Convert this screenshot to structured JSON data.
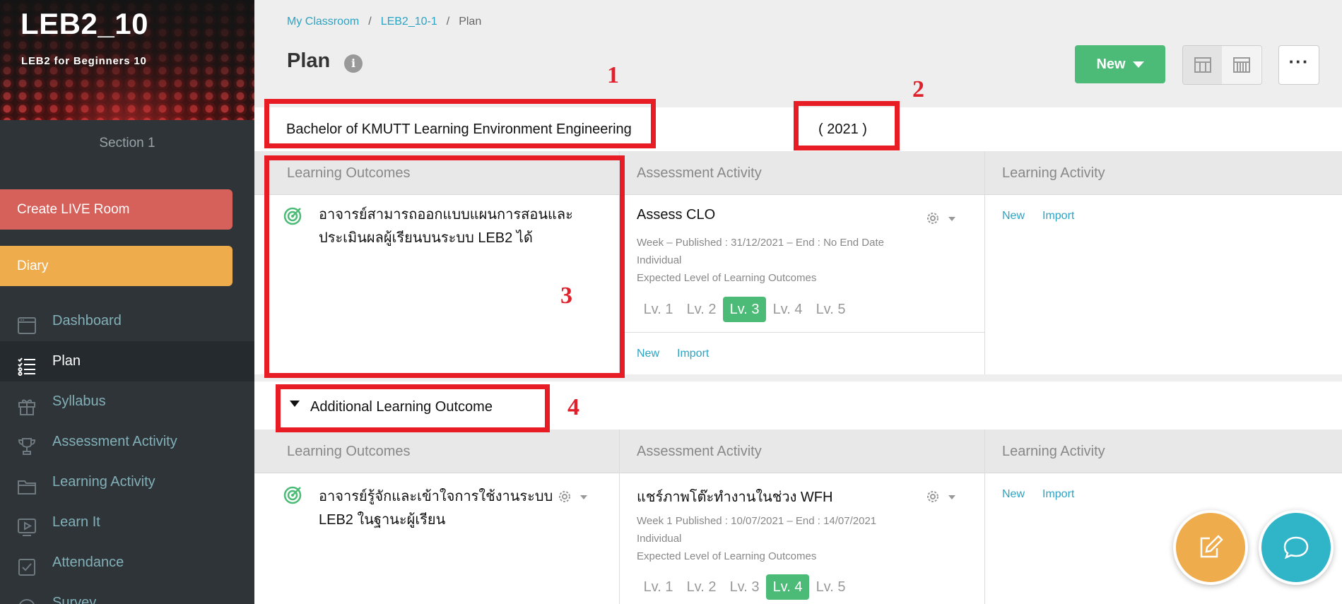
{
  "sidebar": {
    "course_code": "LEB2_10",
    "course_name": "LEB2 for Beginners 10",
    "section": "Section 1",
    "live_button": "Create LIVE Room",
    "diary_button": "Diary",
    "items": [
      {
        "label": "Dashboard",
        "icon": "dashboard-icon"
      },
      {
        "label": "Plan",
        "icon": "list-icon"
      },
      {
        "label": "Syllabus",
        "icon": "gift-icon"
      },
      {
        "label": "Assessment Activity",
        "icon": "trophy-icon"
      },
      {
        "label": "Learning Activity",
        "icon": "folder-icon"
      },
      {
        "label": "Learn It",
        "icon": "video-icon"
      },
      {
        "label": "Attendance",
        "icon": "checkbox-icon"
      },
      {
        "label": "Survey",
        "icon": "smiley-icon"
      }
    ]
  },
  "breadcrumb": {
    "items": [
      "My Classroom",
      "LEB2_10-1",
      "Plan"
    ],
    "separator": "/"
  },
  "header": {
    "title": "Plan",
    "info_icon": "i",
    "new_button": "New",
    "more_button": "···"
  },
  "program": {
    "name": "Bachelor of KMUTT Learning Environment Engineering",
    "year": "( 2021 )"
  },
  "columns": {
    "outcomes": "Learning Outcomes",
    "assessment": "Assessment Activity",
    "learning": "Learning Activity"
  },
  "main_outcome": {
    "text_line1": "อาจารย์สามารถออกแบบแผนการสอนและ",
    "text_line2": "ประเมินผลผู้เรียนบนระบบ LEB2 ได้",
    "activity": {
      "title": "Assess CLO",
      "meta_line1": "Week –   Published : 31/12/2021 – End : No End Date",
      "meta_line2": "Individual",
      "meta_line3": "Expected Level of Learning Outcomes",
      "levels": [
        "Lv. 1",
        "Lv. 2",
        "Lv. 3",
        "Lv. 4",
        "Lv. 5"
      ],
      "selected_level": "Lv. 3"
    },
    "new_link": "New",
    "import_link": "Import"
  },
  "additional": {
    "title": "Additional Learning Outcome",
    "outcome": {
      "text_line1": "อาจารย์รู้จักและเข้าใจการใช้งานระบบ",
      "text_line2": "LEB2 ในฐานะผู้เรียน"
    },
    "activity": {
      "title": "แชร์ภาพโต๊ะทำงานในช่วง WFH",
      "meta_line1": "Week 1   Published : 10/07/2021 – End : 14/07/2021",
      "meta_line2": "Individual",
      "meta_line3": "Expected Level of Learning Outcomes",
      "levels": [
        "Lv. 1",
        "Lv. 2",
        "Lv. 3",
        "Lv. 4",
        "Lv. 5"
      ],
      "selected_level": "Lv. 4"
    },
    "new_link": "New",
    "import_link": "Import"
  },
  "annotations": [
    "1",
    "2",
    "3",
    "4"
  ],
  "colors": {
    "accent_green": "#4cbb77",
    "link_teal": "#2ba3c4",
    "annotation_red": "#e81c24",
    "live_red": "#d6605a",
    "diary_orange": "#efac4c"
  }
}
